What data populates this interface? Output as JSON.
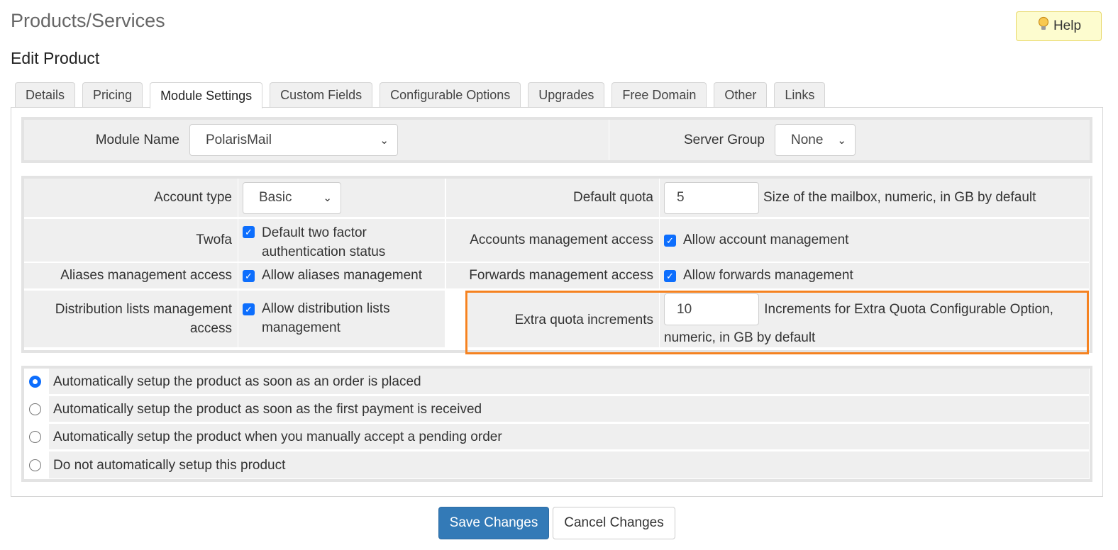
{
  "header": {
    "title": "Products/Services",
    "help_label": "Help",
    "help_icon": "lightbulb-icon"
  },
  "section_title": "Edit Product",
  "tabs": [
    {
      "label": "Details"
    },
    {
      "label": "Pricing"
    },
    {
      "label": "Module Settings",
      "active": true
    },
    {
      "label": "Custom Fields"
    },
    {
      "label": "Configurable Options"
    },
    {
      "label": "Upgrades"
    },
    {
      "label": "Free Domain"
    },
    {
      "label": "Other"
    },
    {
      "label": "Links"
    }
  ],
  "module": {
    "name_label": "Module Name",
    "name_value": "PolarisMail",
    "server_group_label": "Server Group",
    "server_group_value": "None"
  },
  "settings": {
    "account_type_label": "Account type",
    "account_type_value": "Basic",
    "twofa_label": "Twofa",
    "twofa_checkbox": "Default two factor authentication status",
    "aliases_label": "Aliases management access",
    "aliases_checkbox": "Allow aliases management",
    "distribution_label": "Distribution lists management access",
    "distribution_checkbox": "Allow distribution lists management",
    "default_quota_label": "Default quota",
    "default_quota_value": "5",
    "default_quota_help": "Size of the mailbox, numeric, in GB by default",
    "accounts_label": "Accounts management access",
    "accounts_checkbox": "Allow account management",
    "forwards_label": "Forwards management access",
    "forwards_checkbox": "Allow forwards management",
    "extra_quota_label": "Extra quota increments",
    "extra_quota_value": "10",
    "extra_quota_help": "Increments for Extra Quota Configurable Option, numeric, in GB by default"
  },
  "setup_options": [
    {
      "label": "Automatically setup the product as soon as an order is placed",
      "selected": true
    },
    {
      "label": "Automatically setup the product as soon as the first payment is received",
      "selected": false
    },
    {
      "label": "Automatically setup the product when you manually accept a pending order",
      "selected": false
    },
    {
      "label": "Do not automatically setup this product",
      "selected": false
    }
  ],
  "actions": {
    "save_label": "Save Changes",
    "cancel_label": "Cancel Changes"
  },
  "colors": {
    "primary": "#337ab7",
    "highlight": "#f58220",
    "checkbox": "#0d6efd",
    "help_bg": "#fdfccf"
  }
}
